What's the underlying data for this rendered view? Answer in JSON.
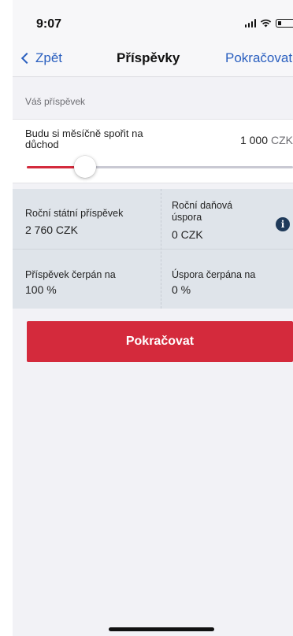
{
  "status_bar": {
    "time": "9:07",
    "icons": [
      "cellular-signal-icon",
      "wifi-icon",
      "battery-icon"
    ]
  },
  "nav": {
    "back_label": "Zpět",
    "title": "Příspěvky",
    "action_label": "Pokračovat"
  },
  "contribution": {
    "section_label": "Váš příspěvek",
    "input_label": "Budu si měsíčně spořit na důchod",
    "amount": "1 000",
    "currency": "CZK",
    "slider_level_fraction": 0.22
  },
  "summary": {
    "state_contribution_label": "Roční státní příspěvek",
    "state_contribution_value": "2 760 CZK",
    "tax_saving_label": "Roční daňová úspora",
    "tax_saving_value": "0 CZK",
    "contribution_used_label": "Příspěvek čerpán na",
    "contribution_used_value": "100 %",
    "saving_used_label": "Úspora čerpána na",
    "saving_used_value": "0 %",
    "info_icon": "info-icon"
  },
  "primary_button_label": "Pokračovat",
  "colors": {
    "accent": "#d42a3c",
    "link": "#2a5fbf",
    "summary_bg": "#dfe4ea",
    "info_icon": "#1f3a5a"
  }
}
